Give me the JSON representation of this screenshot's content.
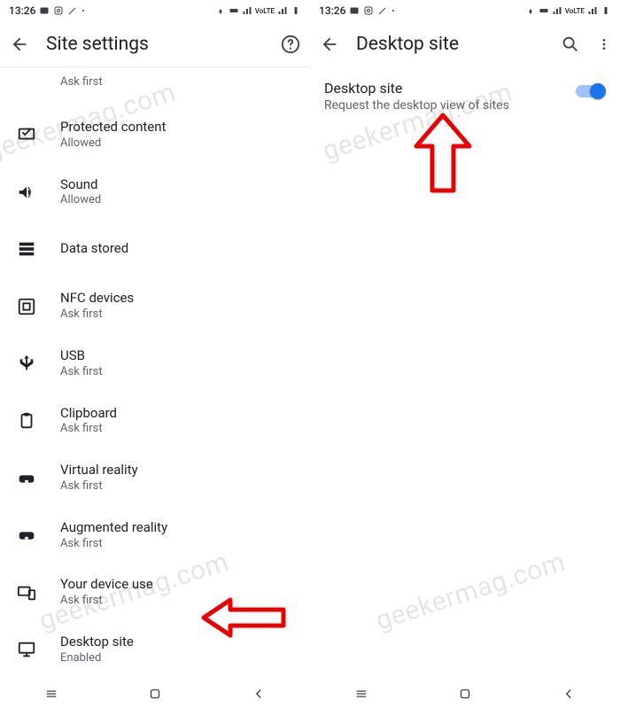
{
  "status": {
    "time": "13:26"
  },
  "watermark": "geekermag.com",
  "left": {
    "title": "Site settings",
    "items": [
      {
        "name": "ask-first-row",
        "primary": "",
        "secondary": "Ask first",
        "icon": ""
      },
      {
        "name": "protected-content-row",
        "primary": "Protected content",
        "secondary": "Allowed",
        "icon": "protected"
      },
      {
        "name": "sound-row",
        "primary": "Sound",
        "secondary": "Allowed",
        "icon": "sound"
      },
      {
        "name": "data-stored-row",
        "primary": "Data stored",
        "secondary": "",
        "icon": "data"
      },
      {
        "name": "nfc-devices-row",
        "primary": "NFC devices",
        "secondary": "Ask first",
        "icon": "nfc"
      },
      {
        "name": "usb-row",
        "primary": "USB",
        "secondary": "Ask first",
        "icon": "usb"
      },
      {
        "name": "clipboard-row",
        "primary": "Clipboard",
        "secondary": "Ask first",
        "icon": "clipboard"
      },
      {
        "name": "virtual-reality-row",
        "primary": "Virtual reality",
        "secondary": "Ask first",
        "icon": "vr"
      },
      {
        "name": "augmented-reality-row",
        "primary": "Augmented reality",
        "secondary": "Ask first",
        "icon": "vr"
      },
      {
        "name": "your-device-use-row",
        "primary": "Your device use",
        "secondary": "Ask first",
        "icon": "device"
      },
      {
        "name": "desktop-site-row",
        "primary": "Desktop site",
        "secondary": "Enabled",
        "icon": "desktop"
      }
    ]
  },
  "right": {
    "title": "Desktop site",
    "detail_primary": "Desktop site",
    "detail_secondary": "Request the desktop view of sites",
    "switch_on": true
  }
}
